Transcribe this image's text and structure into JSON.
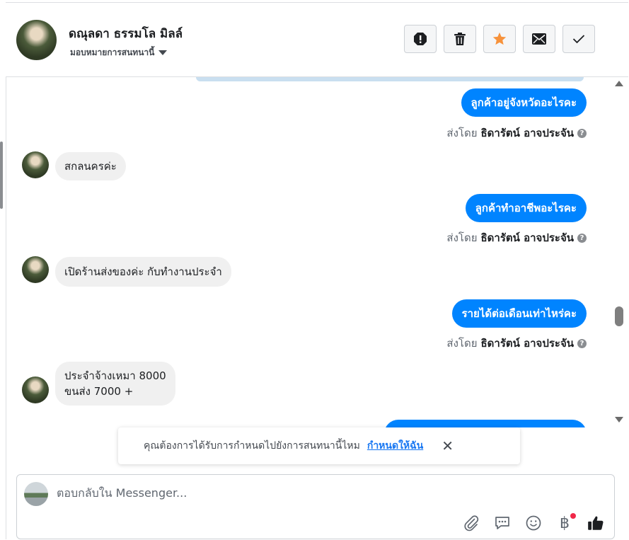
{
  "header": {
    "contact_name": "ดณุลดา ธรรมโล มิลล์",
    "assign_label": "มอบหมายการสนทนานี้",
    "actions": [
      "alert-icon",
      "trash-icon",
      "star-icon",
      "mail-icon",
      "check-icon"
    ],
    "star_color": "#f7923b"
  },
  "messages": [
    {
      "direction": "out",
      "text": "ลูกค้าอยู่จังหวัดอะไรคะ",
      "sent_by_label": "ส่งโดย",
      "sent_by_name": "ธิดารัตน์ อาจประจัน"
    },
    {
      "direction": "in",
      "lines": [
        "สกลนครค่ะ"
      ]
    },
    {
      "direction": "out",
      "text": "ลูกค้าทำอาชีพอะไรคะ",
      "sent_by_label": "ส่งโดย",
      "sent_by_name": "ธิดารัตน์ อาจประจัน"
    },
    {
      "direction": "in",
      "lines": [
        "เปิดร้านส่งของค่ะ กับทำงานประจำ"
      ]
    },
    {
      "direction": "out",
      "text": "รายได้ต่อเดือนเท่าไหร่คะ",
      "sent_by_label": "ส่งโดย",
      "sent_by_name": "ธิดารัตน์ อาจประจัน"
    },
    {
      "direction": "in",
      "lines": [
        "ประจำจ้างเหมา 8000",
        "ขนส่ง 7000 +"
      ]
    }
  ],
  "suggestion": {
    "text": "คุณต้องการได้รับการกำหนดไปยังการสนทนานี้ไหม",
    "link": "กำหนดให้ฉัน",
    "close": "✕"
  },
  "composer": {
    "placeholder": "ตอบกลับใน Messenger...",
    "tools": [
      "attach-icon",
      "saved-reply-icon",
      "emoji-icon",
      "baht-icon",
      "like-icon"
    ],
    "baht_symbol": "฿"
  },
  "colors": {
    "outgoing_bubble": "#0084ff",
    "incoming_bubble": "#f0f0f0",
    "link": "#1877f2",
    "notification_dot": "#f02849"
  }
}
